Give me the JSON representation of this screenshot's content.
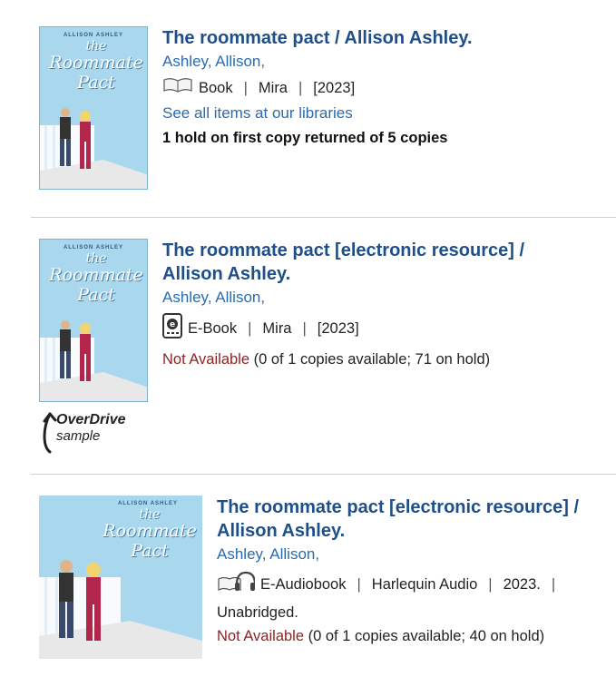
{
  "results": [
    {
      "title": "The roommate pact / Allison Ashley.",
      "author": "Ashley, Allison,",
      "format": "Book",
      "publisher": "Mira",
      "year": "[2023]",
      "see_all": "See all items at our libraries",
      "holds": "1 hold on first copy returned of 5 copies",
      "cover": {
        "author": "ALLISON ASHLEY",
        "title_line1": "the",
        "title_line2": "Roommate",
        "title_line3": "Pact"
      }
    },
    {
      "title_line1": "The roommate pact [electronic resource] /",
      "title_line2": "Allison Ashley.",
      "author": "Ashley, Allison,",
      "format": "E-Book",
      "publisher": "Mira",
      "year": "[2023]",
      "status": "Not Available",
      "availability": "(0 of 1 copies available; 71 on hold)",
      "overdrive_brand": "OverDrive",
      "overdrive_label": "sample",
      "cover": {
        "author": "ALLISON ASHLEY",
        "title_line1": "the",
        "title_line2": "Roommate",
        "title_line3": "Pact"
      }
    },
    {
      "title_line1": "The roommate pact [electronic resource] /",
      "title_line2": "Allison Ashley.",
      "author": "Ashley, Allison,",
      "format": "E-Audiobook",
      "publisher": "Harlequin Audio",
      "year": "2023.",
      "edition": "Unabridged.",
      "status": "Not Available",
      "availability": "(0 of 1 copies available; 40 on hold)",
      "cover": {
        "author": "ALLISON ASHLEY",
        "title_line1": "the",
        "title_line2": "Roommate",
        "title_line3": "Pact"
      }
    }
  ],
  "colors": {
    "title": "#1e4f8a",
    "link": "#2a6bb0",
    "not_available": "#8b2525",
    "cover_bg": "#a9d8ee"
  },
  "icons": [
    "book-icon",
    "ebook-icon",
    "audiobook-icon",
    "overdrive-sample-icon"
  ]
}
